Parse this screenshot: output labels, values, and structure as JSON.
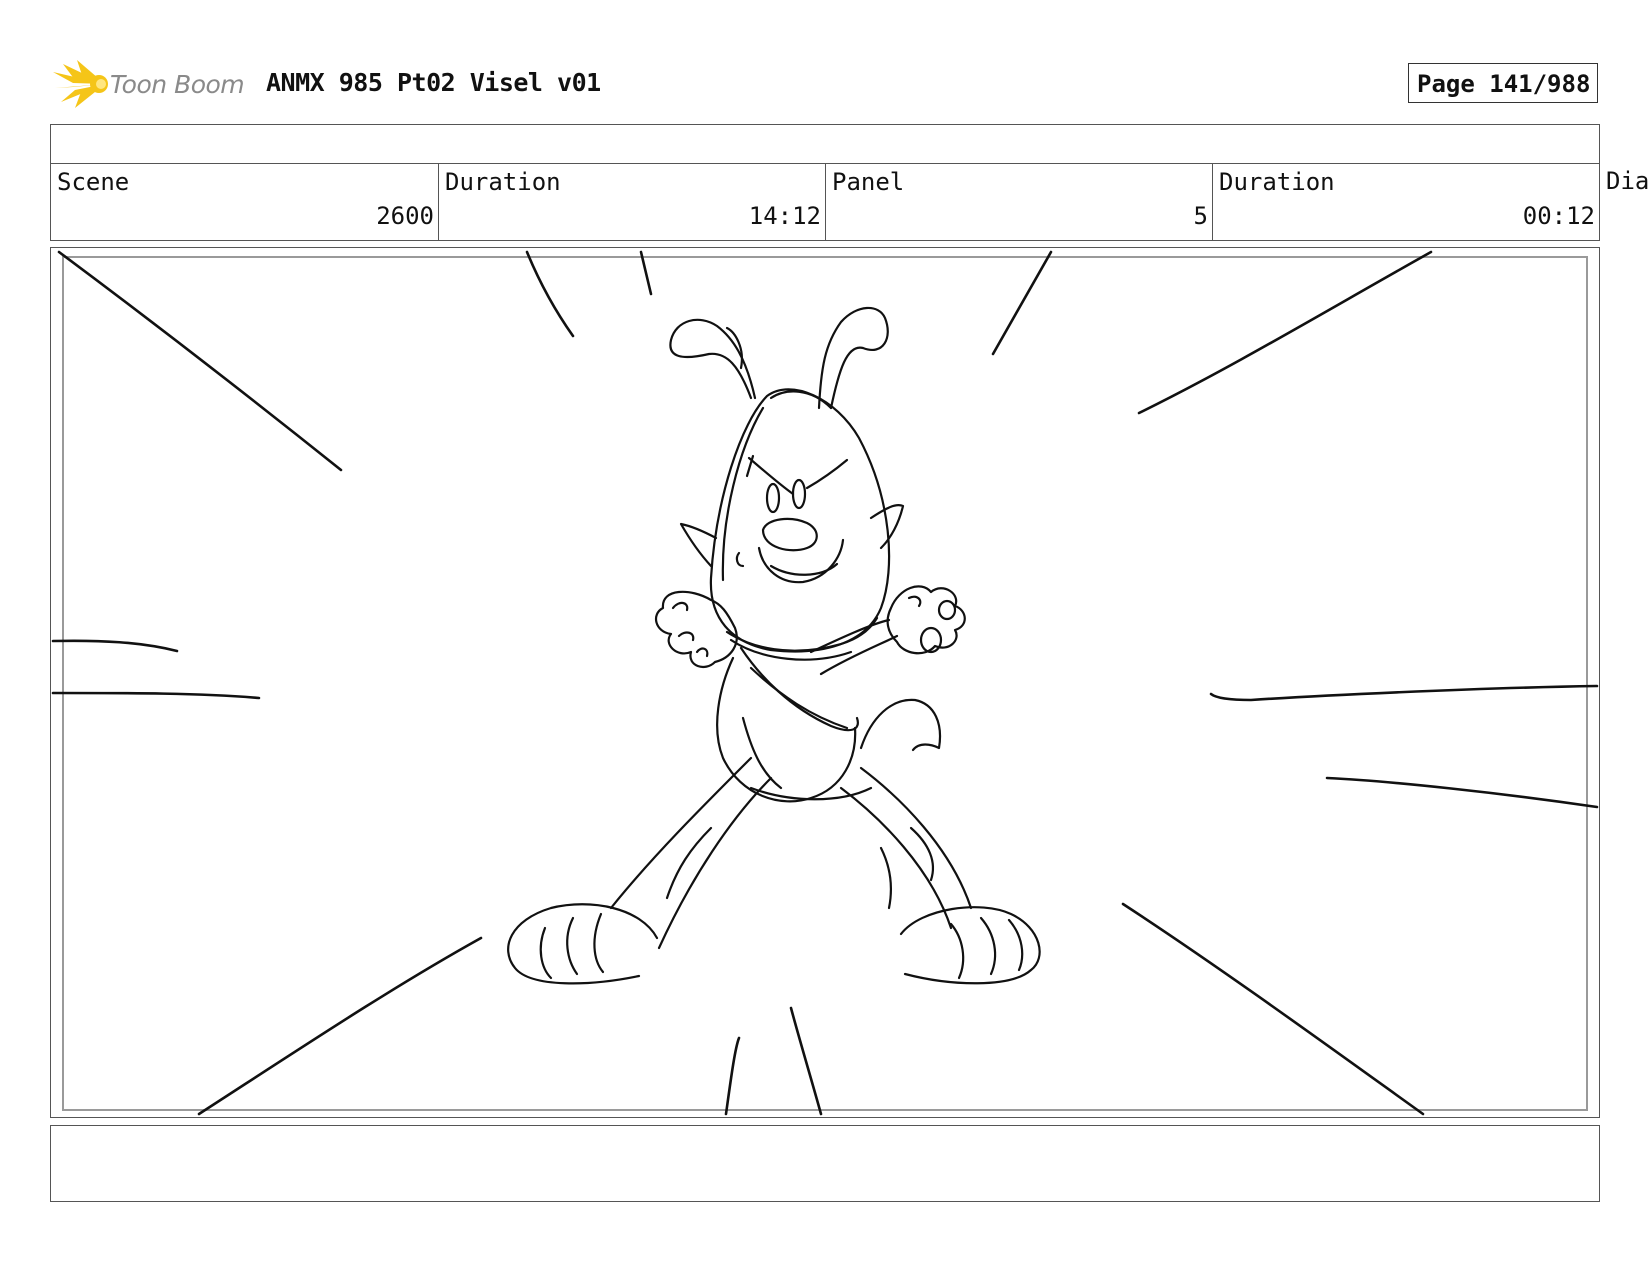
{
  "header": {
    "logo_text": "Toon Boom",
    "title": "ANMX 985 Pt02 Visel v01",
    "page": "Page 141/988"
  },
  "meta": {
    "scene_label": "Scene",
    "scene_value": "2600",
    "scene_duration_label": "Duration",
    "scene_duration_value": "14:12",
    "panel_label": "Panel",
    "panel_value": "5",
    "panel_duration_label": "Duration",
    "panel_duration_value": "00:12",
    "dialogue_label_partial": "Dia"
  },
  "colors": {
    "logo_yellow": "#f5c518",
    "logo_text": "#8a8a8a",
    "border": "#555555",
    "frame": "#9a9a9a"
  }
}
